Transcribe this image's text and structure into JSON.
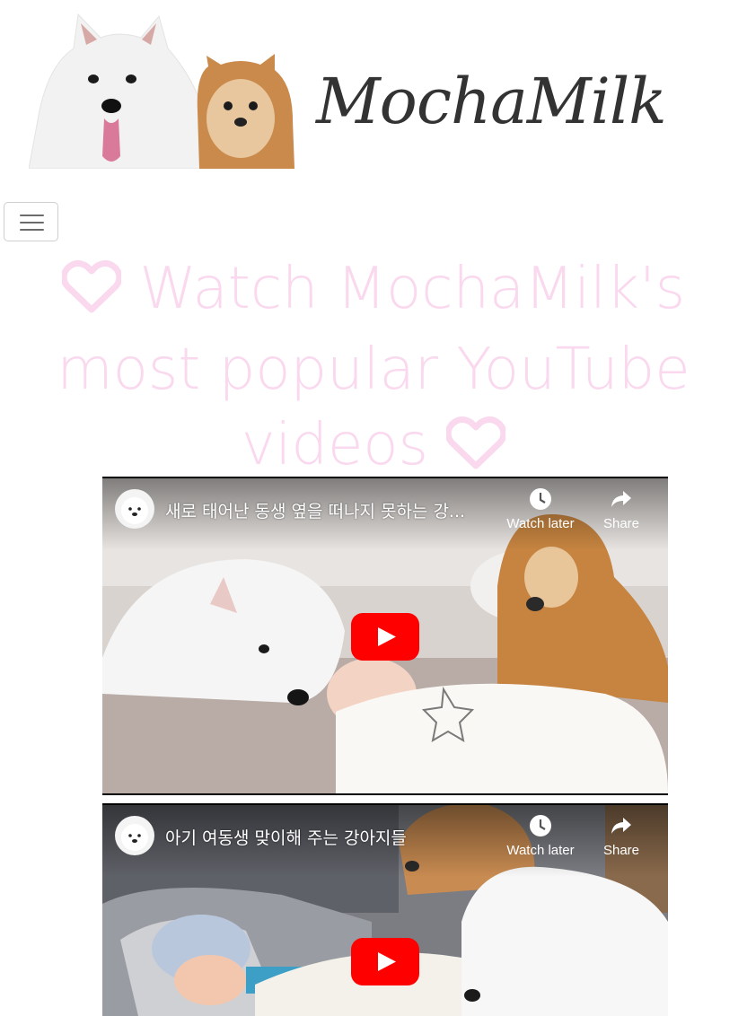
{
  "brand": {
    "name": "MochaMilk"
  },
  "nav": {
    "toggle_icon": "hamburger-menu-icon"
  },
  "heading": {
    "text": "Watch MochaMilk's most popular YouTube videos",
    "color": "#fad9ef",
    "icon": "heart-outline-icon"
  },
  "videos": [
    {
      "title": "새로 태어난 동생 옆을 떠나지 못하는 강...",
      "watch_later": "Watch later",
      "share": "Share"
    },
    {
      "title": "아기 여동생 맞이해 주는 강아지들",
      "watch_later": "Watch later",
      "share": "Share"
    }
  ],
  "colors": {
    "youtube_red": "#ff0000",
    "toggler_border": "#cfcfcf"
  }
}
